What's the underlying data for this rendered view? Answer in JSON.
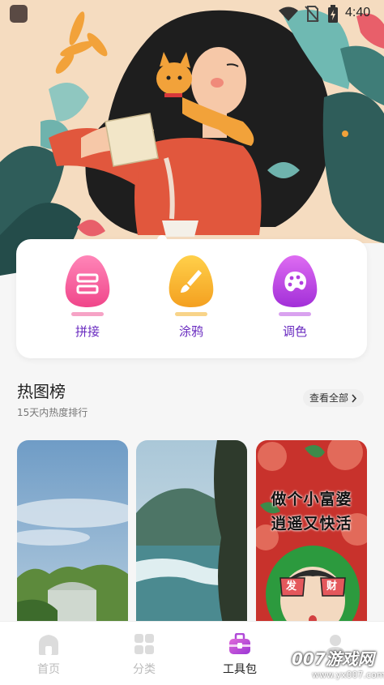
{
  "status_bar": {
    "time": "4:40"
  },
  "tools": [
    {
      "label": "拼接",
      "icon": "stitch-icon"
    },
    {
      "label": "涂鸦",
      "icon": "brush-icon"
    },
    {
      "label": "调色",
      "icon": "palette-icon"
    }
  ],
  "hot_section": {
    "title": "热图榜",
    "subtitle": "15天内热度排行",
    "view_all": "查看全部"
  },
  "thumbnails": {
    "third_line1": "做个小富婆",
    "third_line2": "逍遥又快活",
    "third_sign_left": "发",
    "third_sign_right": "财"
  },
  "bottom_nav": [
    {
      "label": "首页",
      "icon": "home-icon",
      "active": false
    },
    {
      "label": "分类",
      "icon": "category-icon",
      "active": false
    },
    {
      "label": "工具包",
      "icon": "toolbox-icon",
      "active": true
    },
    {
      "label": "",
      "icon": "profile-icon",
      "active": false
    }
  ],
  "watermark": {
    "text": "007游戏网",
    "url": "www.yx007.com"
  },
  "colors": {
    "accent": "#6a2cc0",
    "hero_bg": "#f5dcc0"
  }
}
